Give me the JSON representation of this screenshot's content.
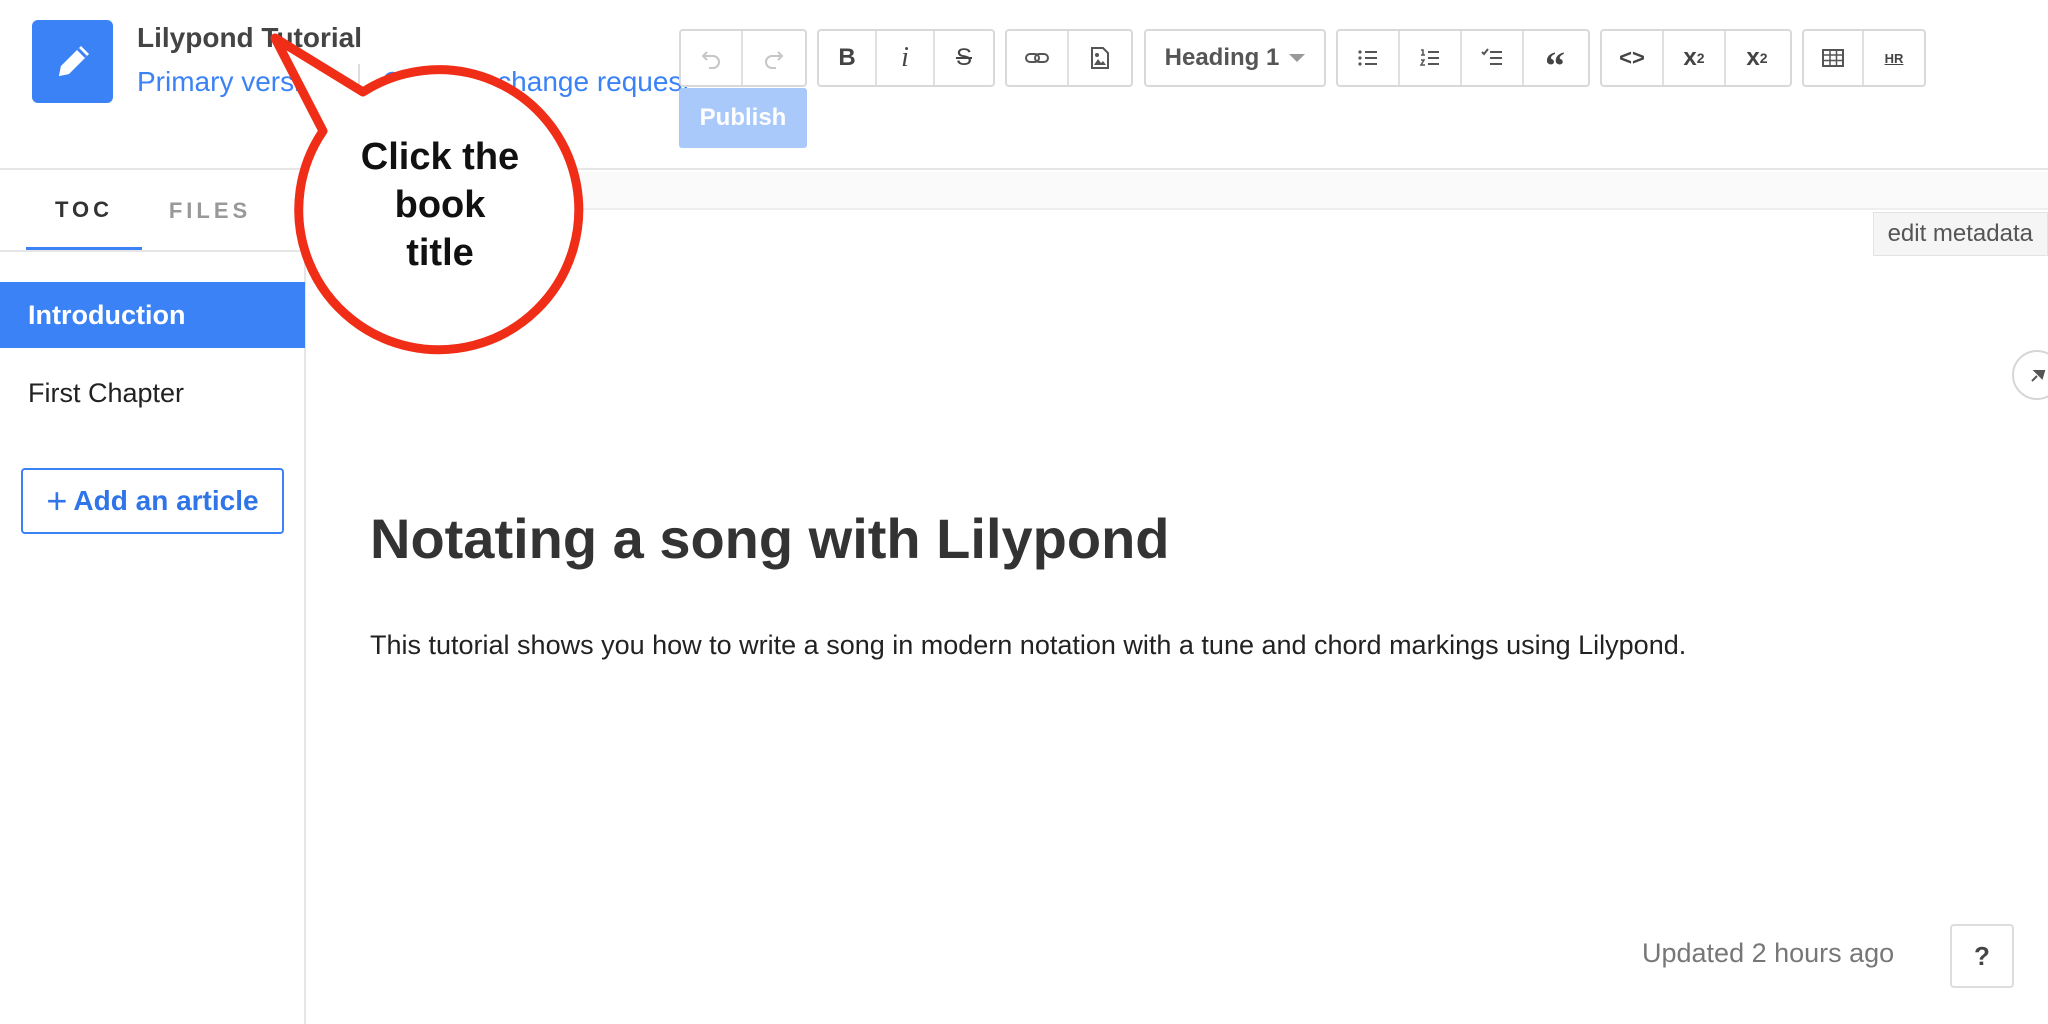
{
  "header": {
    "book_title": "Lilypond Tutorial",
    "version_link": "Primary version",
    "change_link": "Create a change request",
    "app_icon": "pencil-icon"
  },
  "toolbar": {
    "undo_icon": "undo-icon",
    "redo_icon": "redo-icon",
    "bold_label": "B",
    "italic_label": "i",
    "strike_label": "S",
    "link_icon": "link-icon",
    "image_icon": "image-icon",
    "heading_select": "Heading 1",
    "bullet_list_icon": "bullet-list-icon",
    "numbered_list_icon": "numbered-list-icon",
    "checklist_icon": "checklist-icon",
    "quote_label": "“",
    "code_label": "<>",
    "subscript_label": "x",
    "subscript_sub": "2",
    "superscript_label": "x",
    "superscript_sup": "2",
    "table_icon": "table-icon",
    "hr_label": "HR",
    "publish_label": "Publish"
  },
  "sidebar": {
    "tabs": [
      {
        "label": "TOC",
        "active": true
      },
      {
        "label": "FILES",
        "active": false
      }
    ],
    "items": [
      {
        "label": "Introduction",
        "active": true
      },
      {
        "label": "First Chapter",
        "active": false
      }
    ],
    "add_article_label": "Add an article",
    "add_article_plus": "+"
  },
  "editor": {
    "edit_metadata_label": "edit metadata",
    "heading": "Notating a song with Lilypond",
    "paragraph": "This tutorial shows you how to write a song in modern notation with a tune and chord markings using Lilypond.",
    "updated": "Updated 2 hours ago",
    "help_label": "?"
  },
  "callout": {
    "line1": "Click the",
    "line2": "book",
    "line3": "title",
    "stroke_color": "#f02d17"
  },
  "colors": {
    "accent": "#3b82f6",
    "publish_disabled": "#a9c9fb"
  }
}
